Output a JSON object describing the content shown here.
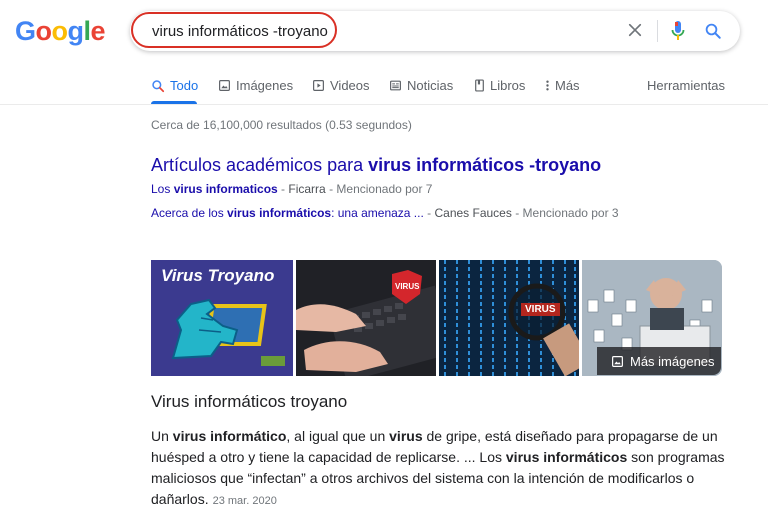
{
  "logo": {
    "letters": [
      "G",
      "o",
      "o",
      "g",
      "l",
      "e"
    ],
    "colors": [
      "#4285f4",
      "#ea4335",
      "#fbbc05",
      "#4285f4",
      "#34a853",
      "#ea4335"
    ]
  },
  "search": {
    "query": "virus informáticos -troyano"
  },
  "tabs": [
    {
      "label": "Todo",
      "icon": "search-icon"
    },
    {
      "label": "Imágenes",
      "icon": "image-icon"
    },
    {
      "label": "Videos",
      "icon": "video-icon"
    },
    {
      "label": "Noticias",
      "icon": "news-icon"
    },
    {
      "label": "Libros",
      "icon": "book-icon"
    },
    {
      "label": "Más",
      "icon": "more-dots-icon"
    }
  ],
  "tools_label": "Herramientas",
  "result_stats": "Cerca de 16,100,000 resultados (0.53 segundos)",
  "scholar": {
    "title_prefix": "Artículos académicos para ",
    "title_bold": "virus informáticos -troyano",
    "items": [
      {
        "link_prefix": "Los ",
        "link_bold": "virus informaticos",
        "link_suffix": "",
        "author": "Ficarra",
        "cited": "Mencionado por 7"
      },
      {
        "link_prefix": "Acerca de los ",
        "link_bold": "virus informáticos",
        "link_suffix": ": una amenaza ...",
        "author": "Canes Fauces",
        "cited": "Mencionado por 3"
      }
    ]
  },
  "images": {
    "thumb1_caption": "Virus Troyano",
    "thumb2_badge": "VIRUS",
    "thumb3_badge": "VIRUS",
    "more_label": "Más imágenes"
  },
  "section_title": "Virus informáticos troyano",
  "snippet": {
    "p1": "Un ",
    "b1": "virus informático",
    "p2": ", al igual que un ",
    "b2": "virus",
    "p3": " de gripe, está diseñado para propagarse de un huésped a otro y tiene la capacidad de replicarse. ... Los ",
    "b3": "virus informáticos",
    "p4": " son programas maliciosos que “infectan” a otros archivos del sistema con la intención de modificarlos o dañarlos.",
    "date": "23 mar. 2020"
  },
  "colors": {
    "link": "#1a0dab",
    "accent": "#1a73e8",
    "highlight": "#d93025"
  }
}
